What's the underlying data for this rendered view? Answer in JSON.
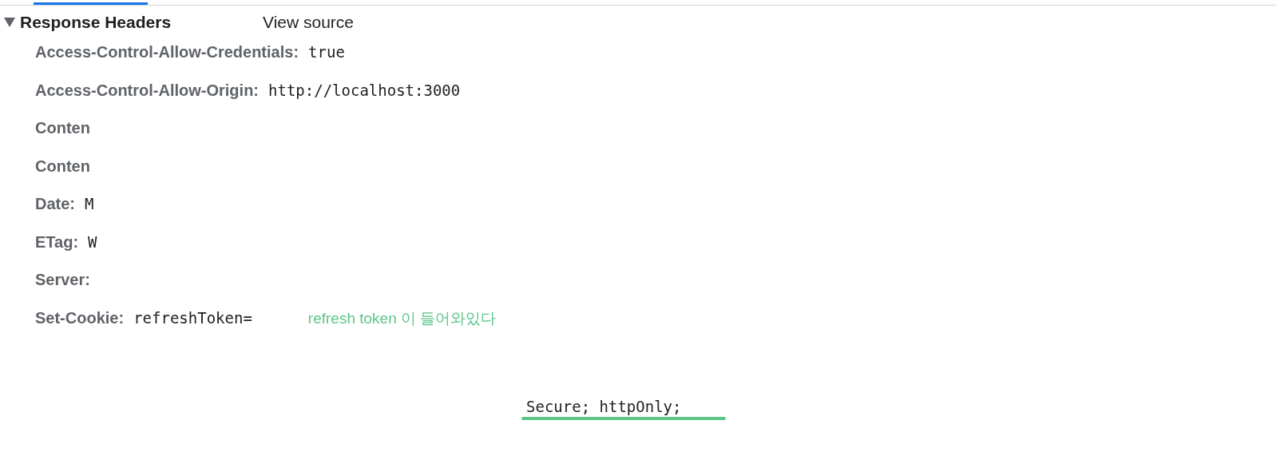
{
  "section": {
    "title": "Response Headers",
    "expanded": true,
    "view_source": "View source"
  },
  "headers": [
    {
      "name": "Access-Control-Allow-Credentials:",
      "value": "true"
    },
    {
      "name": "Access-Control-Allow-Origin:",
      "value": "http://localhost:3000"
    },
    {
      "name": "Conten"
    },
    {
      "name": "Conten"
    },
    {
      "name": "Date:",
      "value": "M"
    },
    {
      "name": "ETag:",
      "value": "W"
    },
    {
      "name": "Server:"
    },
    {
      "name": "Set-Cookie:",
      "value": "refreshToken=",
      "note": "refresh token 이 들어와있다"
    }
  ],
  "cookie_tail": "Secure; httpOnly;"
}
